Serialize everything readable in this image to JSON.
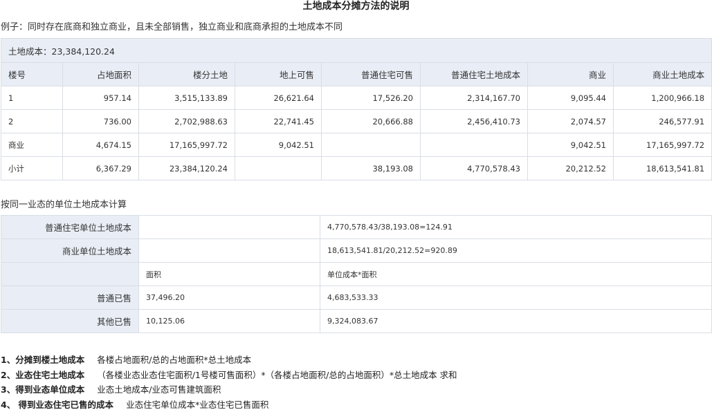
{
  "title": "土地成本分摊方法的说明",
  "example": "例子：同时存在底商和独立商业，且未全部销售，独立商业和底商承担的土地成本不同",
  "table1": {
    "land_cost": "土地成本：23,384,120.24",
    "headers": [
      "楼号",
      "占地面积",
      "楼分土地",
      "地上可售",
      "普通住宅可售",
      "普通住宅土地成本",
      "商业",
      "商业土地成本"
    ],
    "rows": [
      [
        "1",
        "957.14",
        "3,515,133.89",
        "26,621.64",
        "17,526.20",
        "2,314,167.70",
        "9,095.44",
        "1,200,966.18"
      ],
      [
        "2",
        "736.00",
        "2,702,988.63",
        "22,741.45",
        "20,666.88",
        "2,456,410.73",
        "2,074.57",
        "246,577.91"
      ],
      [
        "商业",
        "4,674.15",
        "17,165,997.72",
        "9,042.51",
        "",
        "",
        "9,042.51",
        "17,165,997.72"
      ],
      [
        "小计",
        "6,367.29",
        "23,384,120.24",
        "",
        "38,193.08",
        "4,770,578.43",
        "20,212.52",
        "18,613,541.81"
      ]
    ]
  },
  "subtitle": "按同一业态的单位土地成本计算",
  "table2": {
    "rows": [
      [
        "普通住宅单位土地成本",
        "",
        "4,770,578.43/38,193.08=124.91"
      ],
      [
        "商业单位土地成本",
        "",
        "18,613,541.81/20,212.52=920.89"
      ],
      [
        "",
        "面积",
        "单位成本*面积"
      ],
      [
        "普通已售",
        "37,496.20",
        "4,683,533.33"
      ],
      [
        "其他已售",
        "10,125.06",
        "9,324,083.67"
      ]
    ]
  },
  "notes": [
    {
      "head": "1、分摊到楼土地成本",
      "text": "各楼占地面积/总的占地面积*总土地成本"
    },
    {
      "head": "2、业态住宅土地成本",
      "text": "（各楼业态业态住宅面积/1号楼可售面积）*（各楼占地面积/总的占地面积）*总土地成本  求和"
    },
    {
      "head": "3、得到业态单位成本",
      "text": "业态土地成本/业态可售建筑面积"
    },
    {
      "head": "4、 得到业态住宅已售的成本",
      "text": "业态住宅单位成本*业态住宅已售面积"
    }
  ]
}
